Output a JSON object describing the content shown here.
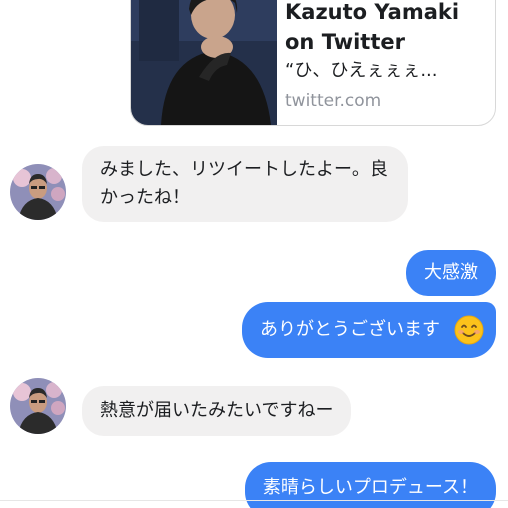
{
  "link_preview": {
    "title": "Kazuto Yamaki\non Twitter",
    "description": "“ひ、ひえぇぇぇ...",
    "domain": "twitter.com"
  },
  "messages": [
    {
      "from": "them",
      "text": "みました、リツイートしたよー。良かったね！"
    },
    {
      "from": "me",
      "text": "大感激"
    },
    {
      "from": "me",
      "text": "ありがとうございます"
    },
    {
      "from": "them",
      "text": "熱意が届いたみたいですねー"
    },
    {
      "from": "me",
      "text": "素晴らしいプロデュース！"
    }
  ],
  "icons": {
    "smile": "smiling-face-emoji"
  },
  "colors": {
    "outgoing_bubble": "#3b82f6",
    "incoming_bubble": "#f1f0f0"
  }
}
